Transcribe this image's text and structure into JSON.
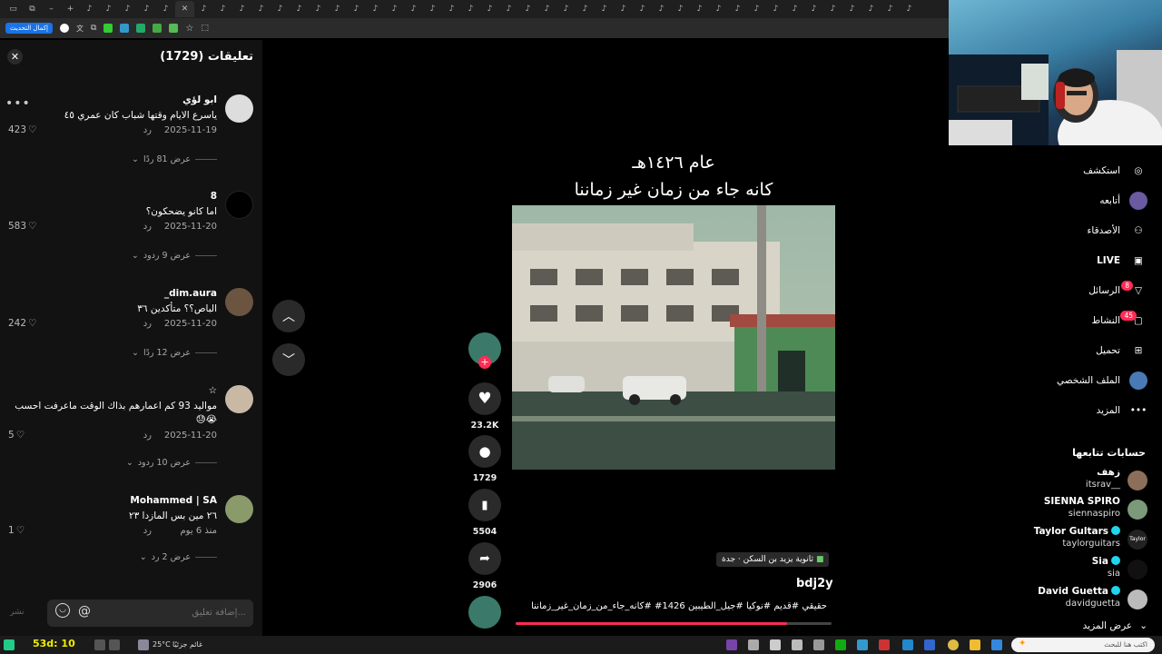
{
  "browser": {
    "update_button": "إكمال التحديث"
  },
  "comments": {
    "title": "تعليقات (1729)",
    "close_icon": "close-icon",
    "items": [
      {
        "user": "ابو لؤي",
        "text": "ياسرع الايام وقتها شباب كان عمري ٤٥",
        "date": "2025-11-19",
        "reply": "رد",
        "likes": "423",
        "view_replies": "عرض 81 ردًا"
      },
      {
        "user": "8",
        "text": "اما كانو يضحكون؟",
        "date": "2025-11-20",
        "reply": "رد",
        "likes": "583",
        "view_replies": "عرض 9 ردود"
      },
      {
        "user": "dim.aura_",
        "text": "الباص؟؟ متأكدين ٣٦",
        "date": "2025-11-20",
        "reply": "رد",
        "likes": "242",
        "view_replies": "عرض 12 ردًا"
      },
      {
        "user": "☆",
        "text": "مواليد 93 كم اعمارهم بذاك الوقت ماعرفت احسب 😭😓",
        "date": "2025-11-20",
        "reply": "رد",
        "likes": "5",
        "view_replies": "عرض 10 ردود"
      },
      {
        "user": "Mohammed | SA",
        "text": "٢٦ مين بس المازدا ٢٣",
        "date": "منذ 6 يوم",
        "reply": "رد",
        "likes": "1",
        "view_replies": "عرض 2 رد"
      }
    ],
    "input_placeholder": "إضافة تعليق...",
    "post_label": "نشر"
  },
  "video": {
    "caption_line1": "عام ١٤٢٦هـ",
    "caption_line2": "كانه جاء من زمان غير زماننا",
    "location": "ثانوية يزيد بن السكن · جدة",
    "author": "bdj2y",
    "hashtags": "حقيقي #قديم #نوكيا #جيل_الطيبين 1426# #كانه_جاء_من_زمان_غير_زماننا",
    "progress": 0.86,
    "likes": "23.2K",
    "comments": "1729",
    "saves": "5504",
    "shares": "2906"
  },
  "sidebar": {
    "items": [
      {
        "label": "استكشف",
        "icon": "compass-icon"
      },
      {
        "label": "أتابعه",
        "icon": "following-avatar-icon"
      },
      {
        "label": "الأصدقاء",
        "icon": "friends-icon"
      },
      {
        "label": "LIVE",
        "icon": "live-icon"
      },
      {
        "label": "الرسائل",
        "icon": "messages-icon",
        "badge": "8"
      },
      {
        "label": "النشاط",
        "icon": "activity-icon",
        "badge": "45"
      },
      {
        "label": "تحميل",
        "icon": "upload-icon"
      },
      {
        "label": "الملف الشخصي",
        "icon": "profile-icon"
      },
      {
        "label": "المزيد",
        "icon": "more-icon"
      }
    ],
    "following_title": "حسابات تتابعها",
    "accounts": [
      {
        "name": "زهف",
        "handle": "itsrav__",
        "verified": false,
        "color": "#8b6f5a"
      },
      {
        "name": "SIENNA SPIRO",
        "handle": "siennaspiro",
        "verified": false,
        "color": "#7a9a7a"
      },
      {
        "name": "Taylor Gultars",
        "handle": "taylorguitars",
        "verified": true,
        "color": "#222222"
      },
      {
        "name": "Sia",
        "handle": "sia",
        "verified": true,
        "color": "#111111"
      },
      {
        "name": "David Guetta",
        "handle": "davidguetta",
        "verified": true,
        "color": "#bbbbbb"
      }
    ],
    "see_more": "عرض المزيد"
  },
  "taskbar": {
    "clock": "53d: 10",
    "weather": "25°C",
    "weather_label": "غائم جزئيًا",
    "search_placeholder": "اكتب هنا للبحث"
  }
}
